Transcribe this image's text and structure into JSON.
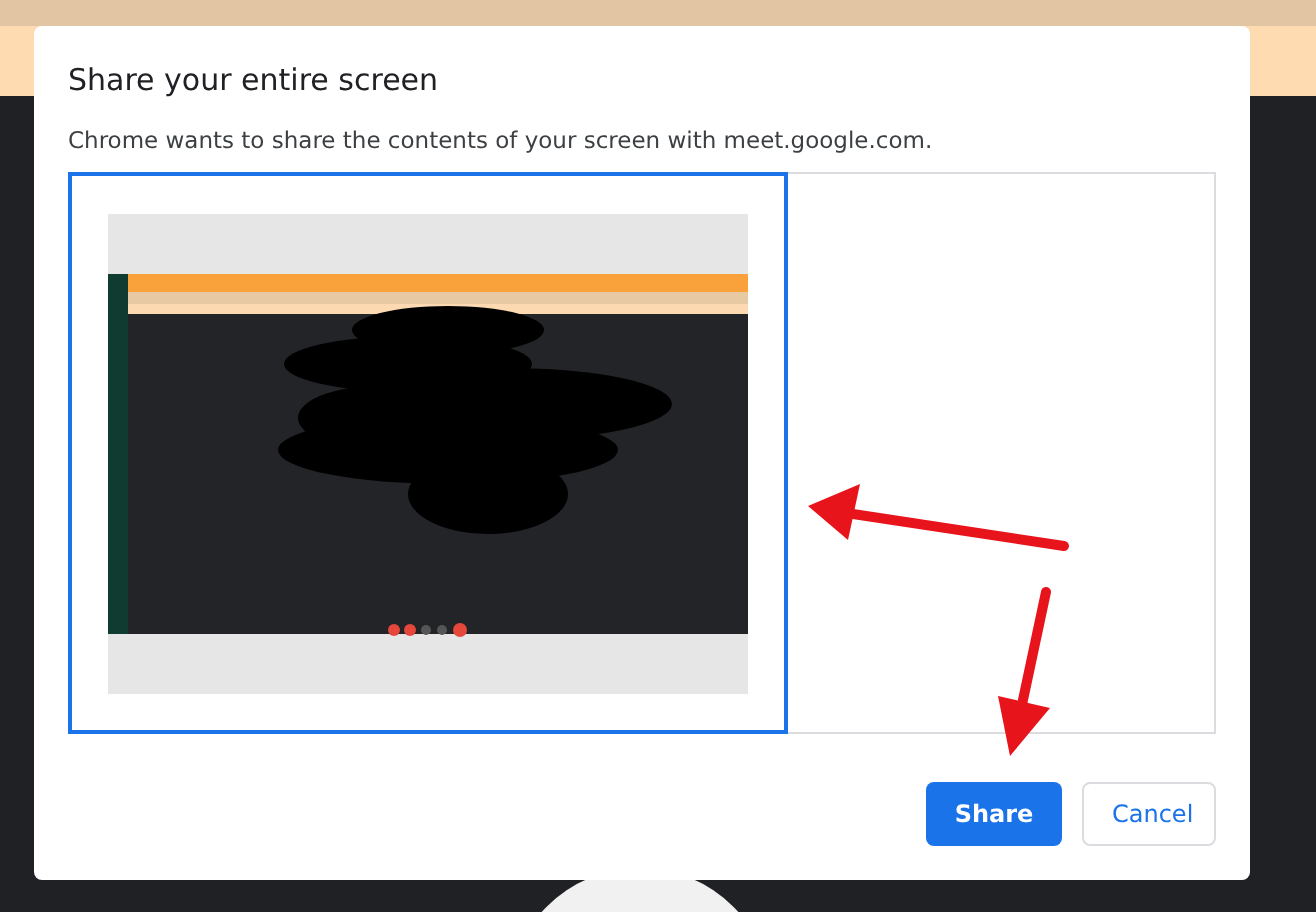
{
  "dialog": {
    "title": "Share your entire screen",
    "message": "Chrome wants to share the contents of your screen with meet.google.com.",
    "sources": [
      {
        "kind": "screen",
        "selected": true
      }
    ],
    "buttons": [
      {
        "label": "Share",
        "kind": "primary"
      },
      {
        "label": "Cancel",
        "kind": "secondary"
      }
    ]
  }
}
